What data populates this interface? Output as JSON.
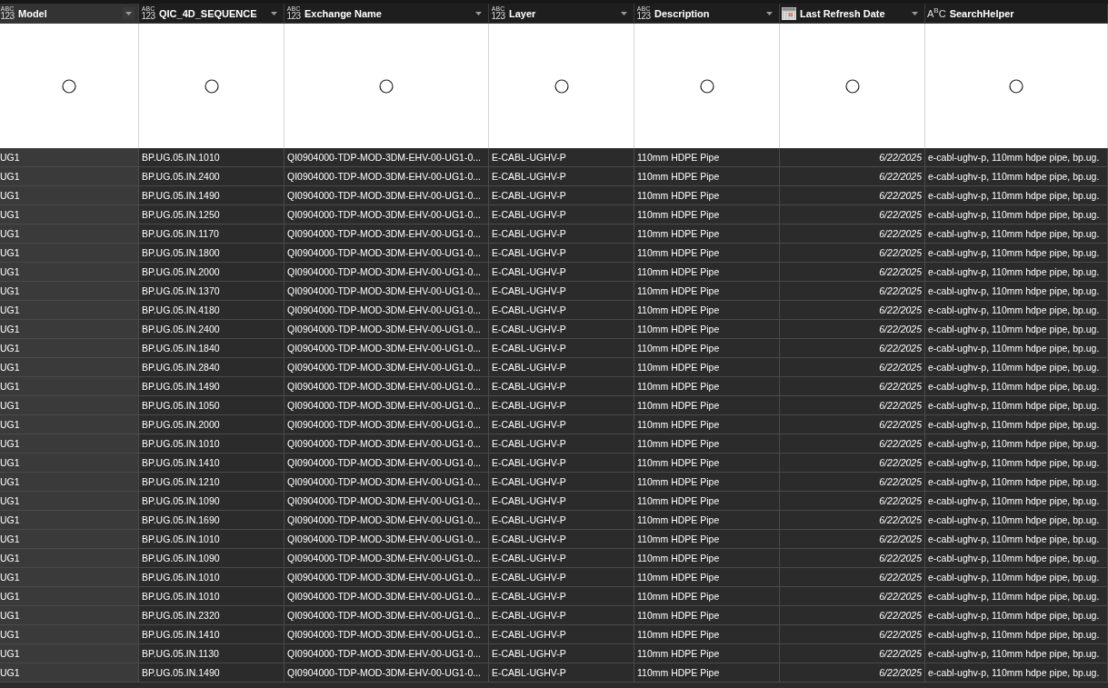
{
  "columns": [
    {
      "label": "Model",
      "kind": "any",
      "type_text": [
        "ABC",
        "123"
      ],
      "selected": true,
      "dropdown": true
    },
    {
      "label": "QIC_4D_SEQUENCE",
      "kind": "any",
      "type_text": [
        "ABC",
        "123"
      ],
      "selected": false,
      "dropdown": true
    },
    {
      "label": "Exchange Name",
      "kind": "any",
      "type_text": [
        "ABC",
        "123"
      ],
      "selected": false,
      "dropdown": true
    },
    {
      "label": "Layer",
      "kind": "any",
      "type_text": [
        "ABC",
        "123"
      ],
      "selected": false,
      "dropdown": true
    },
    {
      "label": "Description",
      "kind": "any",
      "type_text": [
        "ABC",
        "123"
      ],
      "selected": false,
      "dropdown": true
    },
    {
      "label": "Last Refresh Date",
      "kind": "date",
      "selected": false,
      "dropdown": true
    },
    {
      "label": "SearchHelper",
      "kind": "text",
      "type_text": [
        "A$^{B}$C"
      ],
      "selected": false,
      "dropdown": false
    }
  ],
  "rows": [
    {
      "cells": [
        "UG1",
        "BP.UG.05.IN.1010",
        "QI0904000-TDP-MOD-3DM-EHV-00-UG1-0...",
        "E-CABL-UGHV-P",
        "110mm HDPE Pipe",
        "6/22/2025",
        "e-cabl-ughv-p, 110mm hdpe pipe, bp.ug."
      ]
    },
    {
      "cells": [
        "UG1",
        "BP.UG.05.IN.2400",
        "QI0904000-TDP-MOD-3DM-EHV-00-UG1-0...",
        "E-CABL-UGHV-P",
        "110mm HDPE Pipe",
        "6/22/2025",
        "e-cabl-ughv-p, 110mm hdpe pipe, bp.ug."
      ]
    },
    {
      "cells": [
        "UG1",
        "BP.UG.05.IN.1490",
        "QI0904000-TDP-MOD-3DM-EHV-00-UG1-0...",
        "E-CABL-UGHV-P",
        "110mm HDPE Pipe",
        "6/22/2025",
        "e-cabl-ughv-p, 110mm hdpe pipe, bp.ug."
      ]
    },
    {
      "cells": [
        "UG1",
        "BP.UG.05.IN.1250",
        "QI0904000-TDP-MOD-3DM-EHV-00-UG1-0...",
        "E-CABL-UGHV-P",
        "110mm HDPE Pipe",
        "6/22/2025",
        "e-cabl-ughv-p, 110mm hdpe pipe, bp.ug."
      ]
    },
    {
      "cells": [
        "UG1",
        "BP.UG.05.IN.1170",
        "QI0904000-TDP-MOD-3DM-EHV-00-UG1-0...",
        "E-CABL-UGHV-P",
        "110mm HDPE Pipe",
        "6/22/2025",
        "e-cabl-ughv-p, 110mm hdpe pipe, bp.ug."
      ]
    },
    {
      "cells": [
        "UG1",
        "BP.UG.05.IN.1800",
        "QI0904000-TDP-MOD-3DM-EHV-00-UG1-0...",
        "E-CABL-UGHV-P",
        "110mm HDPE Pipe",
        "6/22/2025",
        "e-cabl-ughv-p, 110mm hdpe pipe, bp.ug."
      ]
    },
    {
      "cells": [
        "UG1",
        "BP.UG.05.IN.2000",
        "QI0904000-TDP-MOD-3DM-EHV-00-UG1-0...",
        "E-CABL-UGHV-P",
        "110mm HDPE Pipe",
        "6/22/2025",
        "e-cabl-ughv-p, 110mm hdpe pipe, bp.ug."
      ]
    },
    {
      "cells": [
        "UG1",
        "BP.UG.05.IN.1370",
        "QI0904000-TDP-MOD-3DM-EHV-00-UG1-0...",
        "E-CABL-UGHV-P",
        "110mm HDPE Pipe",
        "6/22/2025",
        "e-cabl-ughv-p, 110mm hdpe pipe, bp.ug."
      ]
    },
    {
      "cells": [
        "UG1",
        "BP.UG.05.IN.4180",
        "QI0904000-TDP-MOD-3DM-EHV-00-UG1-0...",
        "E-CABL-UGHV-P",
        "110mm HDPE Pipe",
        "6/22/2025",
        "e-cabl-ughv-p, 110mm hdpe pipe, bp.ug."
      ]
    },
    {
      "cells": [
        "UG1",
        "BP.UG.05.IN.2400",
        "QI0904000-TDP-MOD-3DM-EHV-00-UG1-0...",
        "E-CABL-UGHV-P",
        "110mm HDPE Pipe",
        "6/22/2025",
        "e-cabl-ughv-p, 110mm hdpe pipe, bp.ug."
      ]
    },
    {
      "cells": [
        "UG1",
        "BP.UG.05.IN.1840",
        "QI0904000-TDP-MOD-3DM-EHV-00-UG1-0...",
        "E-CABL-UGHV-P",
        "110mm HDPE Pipe",
        "6/22/2025",
        "e-cabl-ughv-p, 110mm hdpe pipe, bp.ug."
      ]
    },
    {
      "cells": [
        "UG1",
        "BP.UG.05.IN.2840",
        "QI0904000-TDP-MOD-3DM-EHV-00-UG1-0...",
        "E-CABL-UGHV-P",
        "110mm HDPE Pipe",
        "6/22/2025",
        "e-cabl-ughv-p, 110mm hdpe pipe, bp.ug."
      ]
    },
    {
      "cells": [
        "UG1",
        "BP.UG.05.IN.1490",
        "QI0904000-TDP-MOD-3DM-EHV-00-UG1-0...",
        "E-CABL-UGHV-P",
        "110mm HDPE Pipe",
        "6/22/2025",
        "e-cabl-ughv-p, 110mm hdpe pipe, bp.ug."
      ]
    },
    {
      "cells": [
        "UG1",
        "BP.UG.05.IN.1050",
        "QI0904000-TDP-MOD-3DM-EHV-00-UG1-0...",
        "E-CABL-UGHV-P",
        "110mm HDPE Pipe",
        "6/22/2025",
        "e-cabl-ughv-p, 110mm hdpe pipe, bp.ug."
      ]
    },
    {
      "cells": [
        "UG1",
        "BP.UG.05.IN.2000",
        "QI0904000-TDP-MOD-3DM-EHV-00-UG1-0...",
        "E-CABL-UGHV-P",
        "110mm HDPE Pipe",
        "6/22/2025",
        "e-cabl-ughv-p, 110mm hdpe pipe, bp.ug."
      ]
    },
    {
      "cells": [
        "UG1",
        "BP.UG.05.IN.1010",
        "QI0904000-TDP-MOD-3DM-EHV-00-UG1-0...",
        "E-CABL-UGHV-P",
        "110mm HDPE Pipe",
        "6/22/2025",
        "e-cabl-ughv-p, 110mm hdpe pipe, bp.ug."
      ]
    },
    {
      "cells": [
        "UG1",
        "BP.UG.05.IN.1410",
        "QI0904000-TDP-MOD-3DM-EHV-00-UG1-0...",
        "E-CABL-UGHV-P",
        "110mm HDPE Pipe",
        "6/22/2025",
        "e-cabl-ughv-p, 110mm hdpe pipe, bp.ug."
      ]
    },
    {
      "cells": [
        "UG1",
        "BP.UG.05.IN.1210",
        "QI0904000-TDP-MOD-3DM-EHV-00-UG1-0...",
        "E-CABL-UGHV-P",
        "110mm HDPE Pipe",
        "6/22/2025",
        "e-cabl-ughv-p, 110mm hdpe pipe, bp.ug."
      ]
    },
    {
      "cells": [
        "UG1",
        "BP.UG.05.IN.1090",
        "QI0904000-TDP-MOD-3DM-EHV-00-UG1-0...",
        "E-CABL-UGHV-P",
        "110mm HDPE Pipe",
        "6/22/2025",
        "e-cabl-ughv-p, 110mm hdpe pipe, bp.ug."
      ]
    },
    {
      "cells": [
        "UG1",
        "BP.UG.05.IN.1690",
        "QI0904000-TDP-MOD-3DM-EHV-00-UG1-0...",
        "E-CABL-UGHV-P",
        "110mm HDPE Pipe",
        "6/22/2025",
        "e-cabl-ughv-p, 110mm hdpe pipe, bp.ug."
      ]
    },
    {
      "cells": [
        "UG1",
        "BP.UG.05.IN.1010",
        "QI0904000-TDP-MOD-3DM-EHV-00-UG1-0...",
        "E-CABL-UGHV-P",
        "110mm HDPE Pipe",
        "6/22/2025",
        "e-cabl-ughv-p, 110mm hdpe pipe, bp.ug."
      ]
    },
    {
      "cells": [
        "UG1",
        "BP.UG.05.IN.1090",
        "QI0904000-TDP-MOD-3DM-EHV-00-UG1-0...",
        "E-CABL-UGHV-P",
        "110mm HDPE Pipe",
        "6/22/2025",
        "e-cabl-ughv-p, 110mm hdpe pipe, bp.ug."
      ]
    },
    {
      "cells": [
        "UG1",
        "BP.UG.05.IN.1010",
        "QI0904000-TDP-MOD-3DM-EHV-00-UG1-0...",
        "E-CABL-UGHV-P",
        "110mm HDPE Pipe",
        "6/22/2025",
        "e-cabl-ughv-p, 110mm hdpe pipe, bp.ug."
      ]
    },
    {
      "cells": [
        "UG1",
        "BP.UG.05.IN.1010",
        "QI0904000-TDP-MOD-3DM-EHV-00-UG1-0...",
        "E-CABL-UGHV-P",
        "110mm HDPE Pipe",
        "6/22/2025",
        "e-cabl-ughv-p, 110mm hdpe pipe, bp.ug."
      ]
    },
    {
      "cells": [
        "UG1",
        "BP.UG.05.IN.2320",
        "QI0904000-TDP-MOD-3DM-EHV-00-UG1-0...",
        "E-CABL-UGHV-P",
        "110mm HDPE Pipe",
        "6/22/2025",
        "e-cabl-ughv-p, 110mm hdpe pipe, bp.ug."
      ]
    },
    {
      "cells": [
        "UG1",
        "BP.UG.05.IN.1410",
        "QI0904000-TDP-MOD-3DM-EHV-00-UG1-0...",
        "E-CABL-UGHV-P",
        "110mm HDPE Pipe",
        "6/22/2025",
        "e-cabl-ughv-p, 110mm hdpe pipe, bp.ug."
      ]
    },
    {
      "cells": [
        "UG1",
        "BP.UG.05.IN.1130",
        "QI0904000-TDP-MOD-3DM-EHV-00-UG1-0...",
        "E-CABL-UGHV-P",
        "110mm HDPE Pipe",
        "6/22/2025",
        "e-cabl-ughv-p, 110mm hdpe pipe, bp.ug."
      ]
    },
    {
      "cells": [
        "UG1",
        "BP.UG.05.IN.1490",
        "QI0904000-TDP-MOD-3DM-EHV-00-UG1-0...",
        "E-CABL-UGHV-P",
        "110mm HDPE Pipe",
        "6/22/2025",
        "e-cabl-ughv-p, 110mm hdpe pipe, bp.ug."
      ]
    }
  ]
}
